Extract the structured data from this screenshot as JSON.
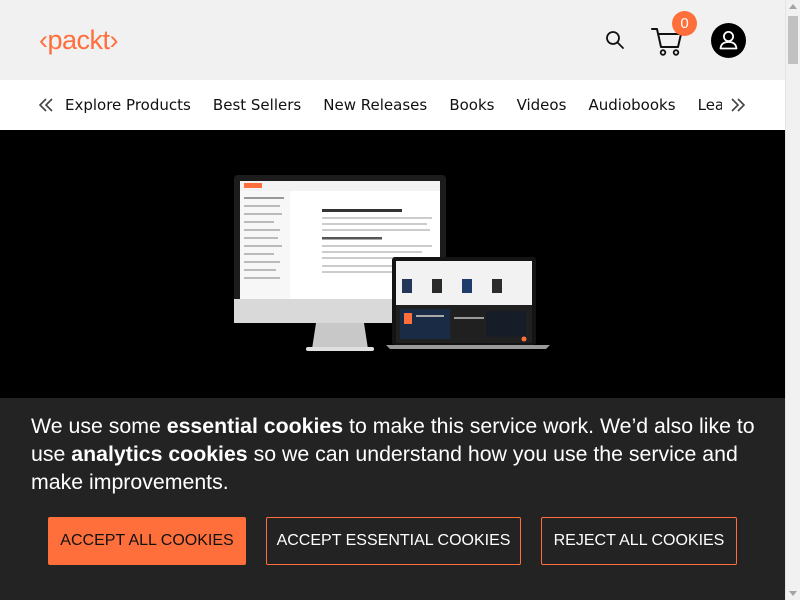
{
  "brand": {
    "logo_text": "‹packt›",
    "accent_color": "#ff6f3c"
  },
  "header": {
    "search_icon": "search-icon",
    "cart_icon": "cart-icon",
    "cart_count": "0",
    "account_icon": "user-icon"
  },
  "nav": {
    "prev_icon": "double-chevron-left-icon",
    "next_icon": "double-chevron-right-icon",
    "items": [
      {
        "label": "Explore Products"
      },
      {
        "label": "Best Sellers"
      },
      {
        "label": "New Releases"
      },
      {
        "label": "Books"
      },
      {
        "label": "Videos"
      },
      {
        "label": "Audiobooks"
      },
      {
        "label": "Learning"
      }
    ]
  },
  "hero": {
    "image": "desktop-and-laptop-devices-image"
  },
  "cookie_banner": {
    "text_1": "We use some ",
    "strong_1": "essential cookies",
    "text_2": " to make this service work. We’d also like to use ",
    "strong_2": "analytics cookies",
    "text_3": " so we can understand how you use the service and make improvements.",
    "accept_all_label": "ACCEPT ALL COOKIES",
    "accept_essential_label": "ACCEPT ESSENTIAL COOKIES",
    "reject_all_label": "REJECT ALL COOKIES"
  }
}
